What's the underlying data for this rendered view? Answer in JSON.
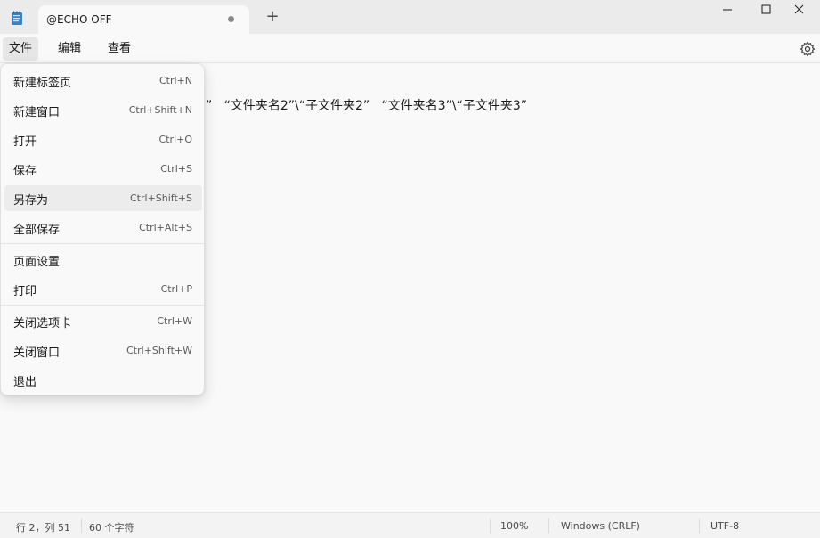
{
  "tab": {
    "title": "@ECHO OFF",
    "new_tab_symbol": "+"
  },
  "menubar": {
    "file": "文件",
    "edit": "编辑",
    "view": "查看"
  },
  "editor": {
    "visible_text": "”   “文件夹名2”\\“子文件夹2”   “文件夹名3”\\“子文件夹3”"
  },
  "file_menu": {
    "items": [
      {
        "label": "新建标签页",
        "shortcut": "Ctrl+N"
      },
      {
        "label": "新建窗口",
        "shortcut": "Ctrl+Shift+N"
      },
      {
        "label": "打开",
        "shortcut": "Ctrl+O"
      },
      {
        "label": "保存",
        "shortcut": "Ctrl+S"
      },
      {
        "label": "另存为",
        "shortcut": "Ctrl+Shift+S"
      },
      {
        "label": "全部保存",
        "shortcut": "Ctrl+Alt+S"
      },
      {
        "label": "页面设置",
        "shortcut": ""
      },
      {
        "label": "打印",
        "shortcut": "Ctrl+P"
      },
      {
        "label": "关闭选项卡",
        "shortcut": "Ctrl+W"
      },
      {
        "label": "关闭窗口",
        "shortcut": "Ctrl+Shift+W"
      },
      {
        "label": "退出",
        "shortcut": ""
      }
    ],
    "highlighted_item": "另存为"
  },
  "status": {
    "position": "行 2，列 51",
    "char_count": "60 个字符",
    "zoom": "100%",
    "line_ending": "Windows (CRLF)",
    "encoding": "UTF-8"
  },
  "icons": {
    "app": "notepad-icon",
    "minimize": "minimize-icon",
    "maximize": "maximize-icon",
    "close": "close-icon",
    "settings": "gear-icon"
  },
  "colors": {
    "titlebar_bg": "#ebebeb",
    "editor_bg": "#f9f9f9",
    "app_icon_blue": "#3b82c4"
  }
}
